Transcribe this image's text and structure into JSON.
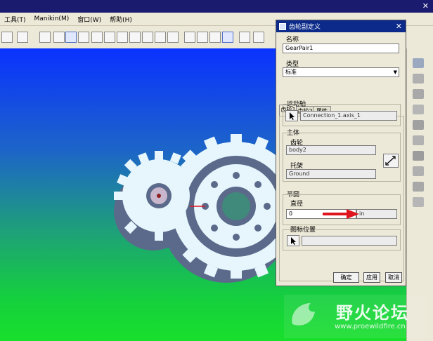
{
  "menubar": {
    "items": [
      "工具(T)",
      "Manikin(M)",
      "窗口(W)",
      "帮助(H)"
    ]
  },
  "dialog": {
    "title": "齿轮副定义",
    "name_label": "名称",
    "name_value": "GearPair1",
    "type_label": "类型",
    "type_value": "标准",
    "tabs": [
      "齿轮1",
      "齿轮2",
      "属性"
    ],
    "motion_axis_label": "运动轴",
    "motion_axis_value": "Connection_1.axis_1",
    "body_label": "主体",
    "gear_label": "齿轮",
    "gear_value": "body2",
    "carrier_label": "托架",
    "carrier_value": "Ground",
    "pitch_circle_label": "节圆",
    "diameter_label": "直径",
    "diameter_value": "0",
    "diameter_unit": "in",
    "icon_position_label": "图标位置",
    "ok_label": "确定",
    "apply_label": "应用",
    "cancel_label": "取消"
  },
  "watermark": {
    "text": "野火论坛",
    "url": "www.proewildfire.cn"
  },
  "colors": {
    "dialog_title_bg": "#0b2a8a",
    "arrow": "#e0141e",
    "gear_fill": "#e6f6fc",
    "gear_shadow": "#5b6a8a"
  }
}
